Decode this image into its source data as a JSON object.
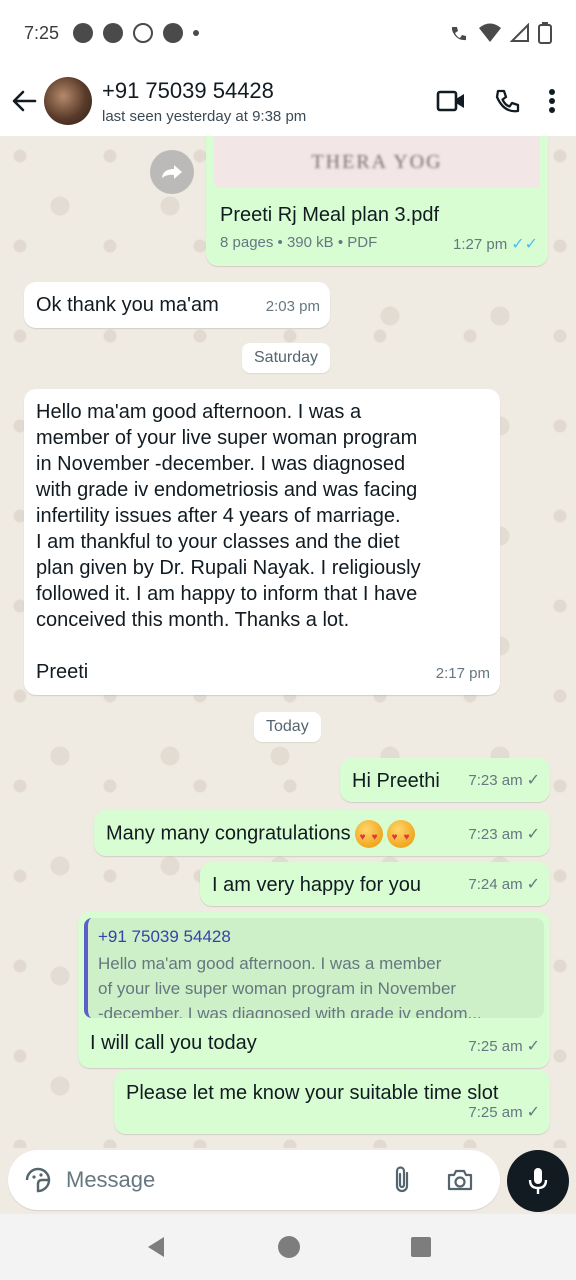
{
  "status_bar": {
    "time": "7:25"
  },
  "header": {
    "contact_name": "+91 75039 54428",
    "last_seen": "last seen yesterday at 9:38 pm"
  },
  "messages": {
    "pdf": {
      "thumb_text": "THERA YOG",
      "filename": "Preeti Rj Meal plan 3.pdf",
      "info": "8 pages • 390 kB • PDF",
      "time": "1:27 pm",
      "status": "read"
    },
    "m1": {
      "text": "Ok thank you ma'am",
      "time": "2:03 pm"
    },
    "date1": "Saturday",
    "m2": {
      "lines": [
        "Hello ma'am good afternoon. I was a",
        "member of your live super woman program",
        "in November -december. I was diagnosed",
        "with grade iv endometriosis and was facing",
        "infertility issues after 4 years of marriage.",
        "I am thankful to your classes and the diet",
        "plan given by Dr. Rupali Nayak. I religiously",
        "followed it. I am happy to inform that I have",
        "conceived this month. Thanks a lot.",
        "",
        "Preeti"
      ],
      "time": "2:17 pm"
    },
    "date2": "Today",
    "m3": {
      "text": "Hi Preethi",
      "time": "7:23 am"
    },
    "m4": {
      "text": "Many many congratulations",
      "time": "7:23 am"
    },
    "m5": {
      "text": "I am very happy for you",
      "time": "7:24 am"
    },
    "m6": {
      "quote_name": "+91 75039 54428",
      "quote_lines": [
        "Hello ma'am good afternoon. I was a member",
        "of your live super woman program in November",
        "-december. I was diagnosed with grade iv endom..."
      ],
      "text": "I will call you today",
      "time": "7:25 am"
    },
    "m7": {
      "text": "Please let me know your suitable time slot",
      "time": "7:25 am"
    }
  },
  "composer": {
    "placeholder": "Message"
  },
  "colors": {
    "outgoing": "#d9fdd3",
    "incoming": "#ffffff",
    "read_tick": "#53bdeb",
    "background": "#efeae2"
  }
}
